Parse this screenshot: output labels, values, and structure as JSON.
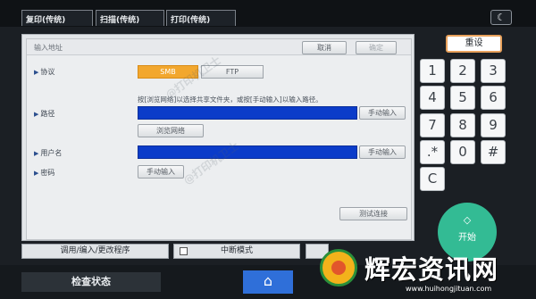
{
  "mode_tabs": [
    {
      "label": "复印(传统)"
    },
    {
      "label": "扫描(传统)"
    },
    {
      "label": "打印(传统)"
    }
  ],
  "top_icon": "moon-icon",
  "dialog": {
    "title": "输入地址",
    "cancel": "取消",
    "ok": "确定",
    "protocol_label": "协议",
    "protocol_options": [
      "SMB",
      "FTP"
    ],
    "protocol_selected": "SMB",
    "hint": "按[浏览网络]以选择共享文件夹，或按[手动输入]以输入路径。",
    "path_label": "路径",
    "path_value": "",
    "manual_input": "手动输入",
    "browse_network": "浏览网络",
    "username_label": "用户名",
    "username_value": "",
    "password_label": "密码",
    "test_connection": "测试连接"
  },
  "watermark": "@打印机卫士",
  "keypad": {
    "reset": "重设",
    "keys": [
      "1",
      "2",
      "3",
      "4",
      "5",
      "6",
      "7",
      "8",
      "9",
      ".*",
      "0",
      "#",
      "C"
    ],
    "start": "开始"
  },
  "bottom": {
    "program": "调用/编入/更改程序",
    "interrupt": "中断模式",
    "status": "检查状态"
  },
  "brand": {
    "name": "辉宏资讯网",
    "url": "www.huihongjituan.com"
  },
  "colors": {
    "accent_orange": "#f2a72e",
    "field_blue": "#0b3cc9",
    "start_green": "#33bb94",
    "home_blue": "#2f6fd9"
  }
}
